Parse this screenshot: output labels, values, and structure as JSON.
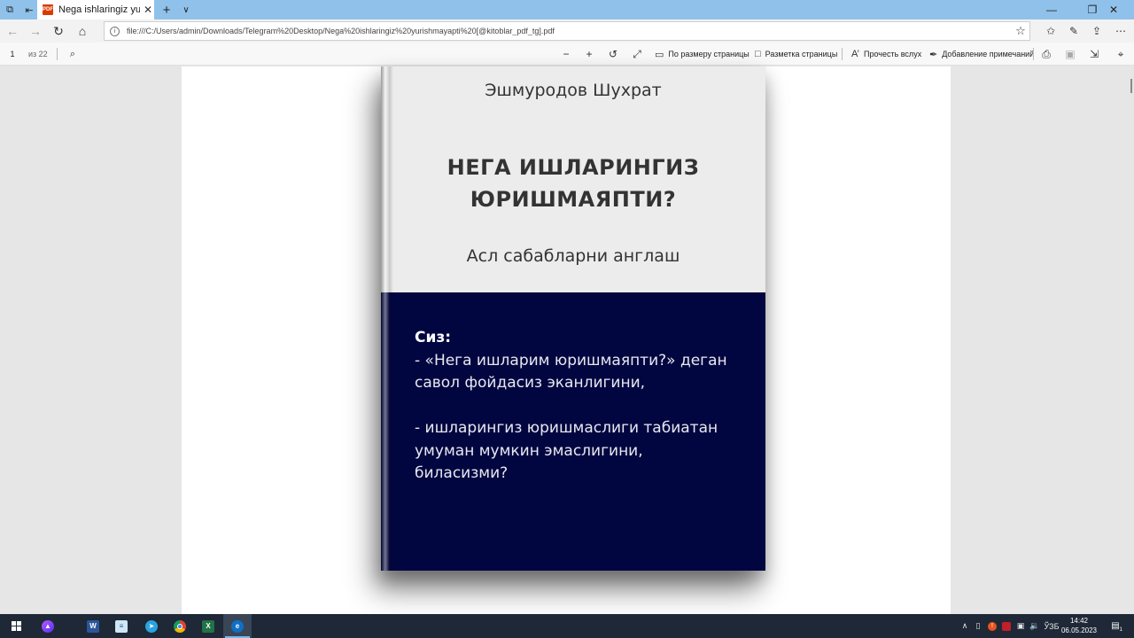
{
  "browser": {
    "tab": {
      "title": "Nega ishlaringiz yurishm",
      "favicon": "pdf-icon"
    },
    "address": {
      "url": "file:///C:/Users/admin/Downloads/Telegram%20Desktop/Nega%20ishlaringiz%20yurishmayapti%20[@kitoblar_pdf_tg].pdf"
    },
    "window_controls": [
      "minimize-icon",
      "restore-icon",
      "close-icon"
    ]
  },
  "pdf_toolbar": {
    "page_current": "1",
    "page_total_label": "из 22",
    "fit_page_label": "По размеру страницы",
    "page_layout_label": "Разметка страницы",
    "read_aloud_label": "Прочесть вслух",
    "add_notes_label": "Добавление примечаний"
  },
  "document": {
    "author": "Эшмуродов Шухрат",
    "title_line1": "НЕГА ИШЛАРИНГИЗ",
    "title_line2": "ЮРИШМАЯПТИ?",
    "subtitle": "Асл сабабларни англаш",
    "blurb": {
      "heading": "Сиз:",
      "line1": "- «Нега ишларим юришмаяпти?» деган",
      "line2": "савол фойдасиз эканлигини,",
      "line3": "- ишларингиз юришмаслиги табиатан",
      "line4": "умуман мумкин эмаслигини,",
      "line5": "биласизми?"
    },
    "colors": {
      "cover_top": "#ececec",
      "cover_bottom": "#020640"
    }
  },
  "taskbar": {
    "apps": [
      "alice-icon",
      "word-icon",
      "notepad-icon",
      "telegram-icon",
      "chrome-icon",
      "excel-icon",
      "edge-icon"
    ],
    "language": "ЎЗБ",
    "time": "14:42",
    "date": "06.05.2023",
    "notification_count": "1"
  }
}
